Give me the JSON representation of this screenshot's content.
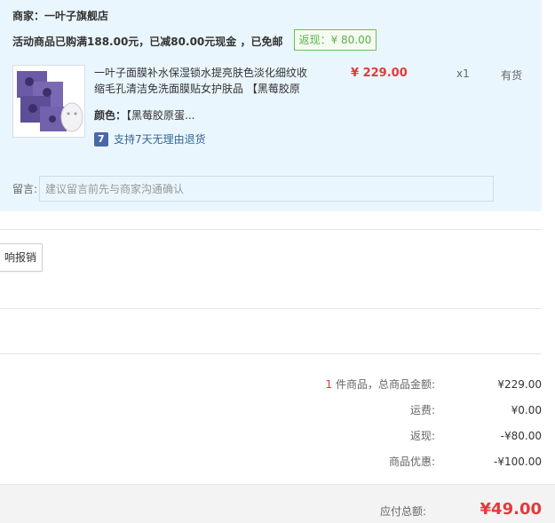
{
  "store": {
    "merchant_label": "商家：一叶子旗舰店",
    "promo_text": "活动商品已购满188.00元，已减80.00元现金 ，已免邮",
    "rebate_badge": "返现：¥ 80.00"
  },
  "item": {
    "title": "一叶子面膜补水保湿锁水提亮肤色淡化细纹收缩毛孔清洁免洗面膜贴女护肤品 【黑莓胶原",
    "price": "¥ 229.00",
    "quantity": "x1",
    "stock": "有货",
    "color_label": "颜色：",
    "color_value": "【黑莓胶原蛋...",
    "return_policy": "支持7天无理由退货"
  },
  "note": {
    "label": "留言:",
    "placeholder": "建议留言前先与商家沟通确认"
  },
  "reimburse_button": "响报销",
  "summary": {
    "item_count": "1",
    "goods_label": "件商品，总商品金额:",
    "goods_value": "¥229.00",
    "shipping_label": "运费:",
    "shipping_value": "¥0.00",
    "rebate_label": "返现:",
    "rebate_value": "-¥80.00",
    "discount_label": "商品优惠:",
    "discount_value": "-¥100.00"
  },
  "total": {
    "label": "应付总额:",
    "value": "¥49.00"
  },
  "colors": {
    "accent_red": "#e4393c",
    "rebate_green": "#5bb24a",
    "panel_bg": "#eaf6fd",
    "link_blue": "#336699"
  }
}
